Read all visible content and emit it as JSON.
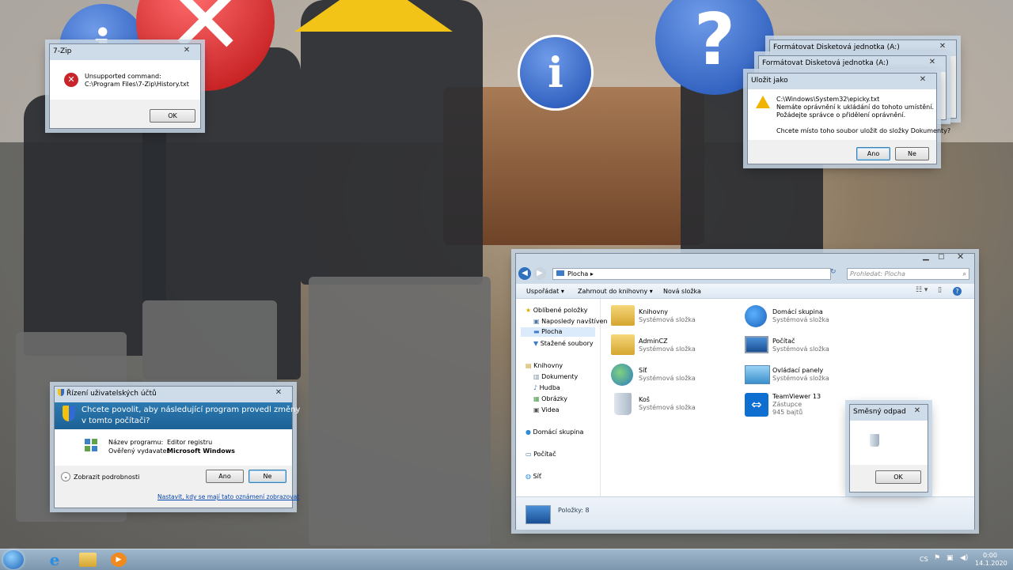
{
  "zip_dialog": {
    "title": "7-Zip",
    "line1": "Unsupported command:",
    "line2": "C:\\Program Files\\7-Zip\\History.txt",
    "ok": "OK"
  },
  "format_dialog_1": {
    "title": "Formátovat Disketová jednotka (A:)"
  },
  "format_dialog_2": {
    "title": "Formátovat Disketová jednotka (A:)"
  },
  "save_dialog": {
    "title": "Uložit jako",
    "path": "C:\\Windows\\System32\\epicky.txt",
    "line1": "Nemáte oprávnění k ukládání do tohoto umístění.",
    "line2": "Požádejte správce o přidělení oprávnění.",
    "question": "Chcete místo toho soubor uložit do složky Dokumenty?",
    "yes": "Ano",
    "no": "Ne"
  },
  "uac": {
    "title": "Řízení uživatelských účtů",
    "header_line1": "Chcete povolit, aby následující program provedl změny",
    "header_line2": "v tomto počítači?",
    "program_label": "Název programu:",
    "program_value": "Editor registru",
    "publisher_label": "Ověřený vydavatel:",
    "publisher_value": "Microsoft Windows",
    "details": "Zobrazit podrobnosti",
    "yes": "Ano",
    "no": "Ne",
    "link": "Nastavit, kdy se mají tato oznámení zobrazovat"
  },
  "explorer": {
    "address": "Plocha",
    "search_placeholder": "Prohledat: Plocha",
    "toolbar": {
      "organize": "Uspořádat",
      "include": "Zahrnout do knihovny",
      "new_folder": "Nová složka"
    },
    "nav": {
      "favorites": "Oblíbené položky",
      "recent": "Naposledy navštíven",
      "desktop": "Plocha",
      "downloads": "Stažené soubory",
      "libraries": "Knihovny",
      "documents": "Dokumenty",
      "music": "Hudba",
      "pictures": "Obrázky",
      "videos": "Videa",
      "homegroup": "Domácí skupina",
      "computer": "Počítač",
      "network": "Síť"
    },
    "items": [
      {
        "name": "Knihovny",
        "sub": "Systémová složka",
        "icon": "libraries-icon"
      },
      {
        "name": "Domácí skupina",
        "sub": "Systémová složka",
        "icon": "homegroup-icon"
      },
      {
        "name": "AdminCZ",
        "sub": "Systémová složka",
        "icon": "user-folder-icon"
      },
      {
        "name": "Počítač",
        "sub": "Systémová složka",
        "icon": "computer-icon"
      },
      {
        "name": "Síť",
        "sub": "Systémová složka",
        "icon": "network-icon"
      },
      {
        "name": "Ovládací panely",
        "sub": "Systémová složka",
        "icon": "control-panel-icon"
      },
      {
        "name": "Koš",
        "sub": "Systémová složka",
        "icon": "recycle-bin-icon"
      },
      {
        "name": "TeamViewer 13",
        "sub": "Zástupce",
        "sub2": "945 bajtů",
        "icon": "teamviewer-icon"
      }
    ],
    "status": "Položky: 8"
  },
  "funny_dialog": {
    "title": "Směsný odpad",
    "ok": "OK"
  },
  "taskbar": {
    "lang": "CS",
    "time": "0:00",
    "date": "14.1.2020"
  }
}
